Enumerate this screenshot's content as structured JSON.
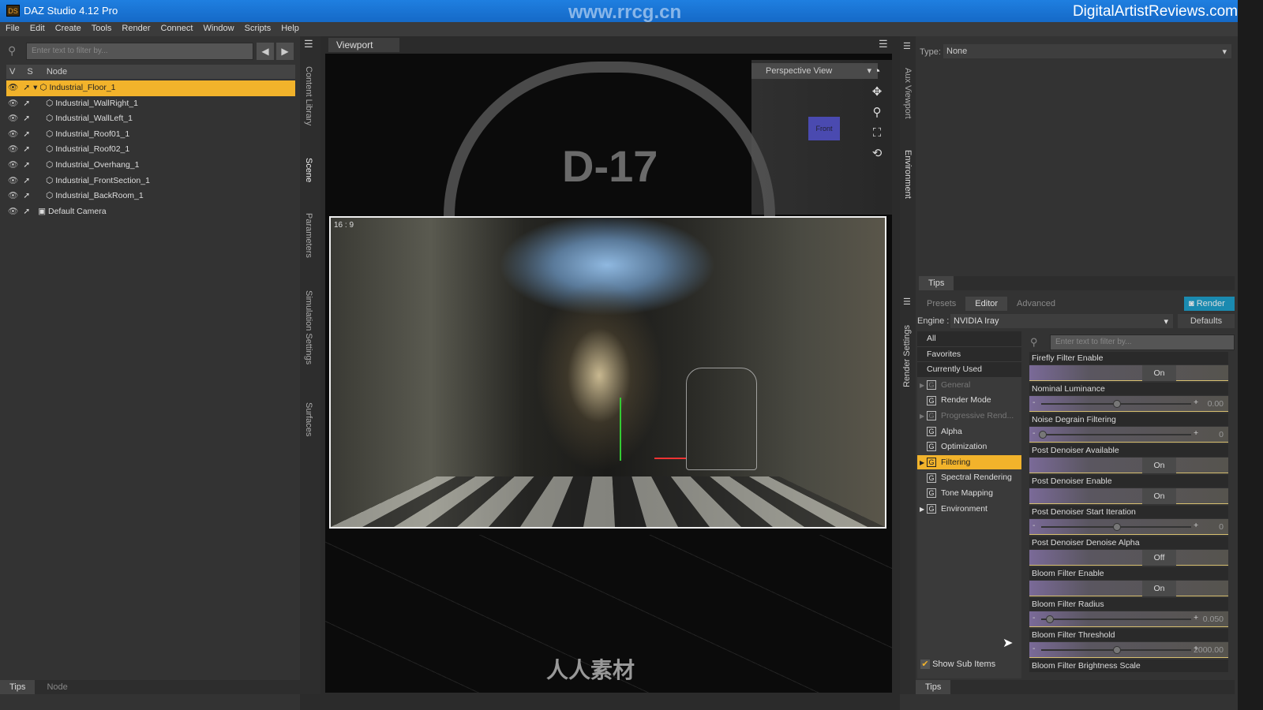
{
  "titlebar": {
    "app_icon": "DS",
    "title": "DAZ Studio 4.12 Pro",
    "watermark_center": "www.rrcg.cn",
    "watermark_right": "DigitalArtistReviews.com"
  },
  "menu": [
    "File",
    "Edit",
    "Create",
    "Tools",
    "Render",
    "Connect",
    "Window",
    "Scripts",
    "Help"
  ],
  "scene": {
    "filter_placeholder": "Enter text to filter by...",
    "columns": [
      "V",
      "S",
      "Node"
    ],
    "nodes": [
      {
        "label": "Industrial_Floor_1",
        "selected": true
      },
      {
        "label": "Industrial_WallRight_1"
      },
      {
        "label": "Industrial_WallLeft_1"
      },
      {
        "label": "Industrial_Roof01_1"
      },
      {
        "label": "Industrial_Roof02_1"
      },
      {
        "label": "Industrial_Overhang_1"
      },
      {
        "label": "Industrial_FrontSection_1"
      },
      {
        "label": "Industrial_BackRoom_1"
      },
      {
        "label": "Default Camera"
      }
    ],
    "bottom_tabs": [
      "Tips",
      "Node"
    ]
  },
  "side_tabs": [
    "Content Library",
    "Scene",
    "Parameters",
    "Simulation Settings",
    "Surfaces"
  ],
  "viewport": {
    "tab": "Viewport",
    "view": "Perspective View",
    "aspect": "16 : 9",
    "cube_label": "Front",
    "bottom_logo": "人人素材"
  },
  "aux": {
    "type_label": "Type:",
    "type_value": "None",
    "side_tabs": [
      "Aux Viewport",
      "Environment"
    ],
    "tips": "Tips"
  },
  "render_settings": {
    "side_tab": "Render Settings",
    "tabs": [
      "Presets",
      "Editor",
      "Advanced"
    ],
    "active_tab": "Editor",
    "render_button": "Render",
    "engine_label": "Engine :",
    "engine_value": "NVIDIA Iray",
    "defaults_button": "Defaults",
    "filter_placeholder": "Enter text to filter by...",
    "categories": [
      "All",
      "Favorites",
      "Currently Used",
      "General",
      "Render Mode",
      "Progressive Rend...",
      "Alpha",
      "Optimization",
      "Filtering",
      "Spectral Rendering",
      "Tone Mapping",
      "Environment"
    ],
    "selected_category": "Filtering",
    "show_sub_items": "Show Sub Items",
    "properties": [
      {
        "label": "Firefly Filter Enable",
        "type": "toggle",
        "value": "On"
      },
      {
        "label": "Nominal Luminance",
        "type": "slider",
        "value": "0.00",
        "fraction": 0.5
      },
      {
        "label": "Noise Degrain Filtering",
        "type": "slider",
        "value": "0",
        "fraction": 0.0
      },
      {
        "label": "Post Denoiser Available",
        "type": "toggle",
        "value": "On"
      },
      {
        "label": "Post Denoiser Enable",
        "type": "toggle",
        "value": "On"
      },
      {
        "label": "Post Denoiser Start Iteration",
        "type": "slider",
        "value": "0",
        "fraction": 0.5
      },
      {
        "label": "Post Denoiser Denoise Alpha",
        "type": "toggle",
        "value": "Off"
      },
      {
        "label": "Bloom Filter Enable",
        "type": "toggle",
        "value": "On"
      },
      {
        "label": "Bloom Filter Radius",
        "type": "slider",
        "value": "0.050",
        "fraction": 0.05
      },
      {
        "label": "Bloom Filter Threshold",
        "type": "slider",
        "value": "2000.00",
        "fraction": 0.5
      },
      {
        "label": "Bloom Filter Brightness Scale",
        "type": "label"
      }
    ],
    "tips": "Tips"
  }
}
